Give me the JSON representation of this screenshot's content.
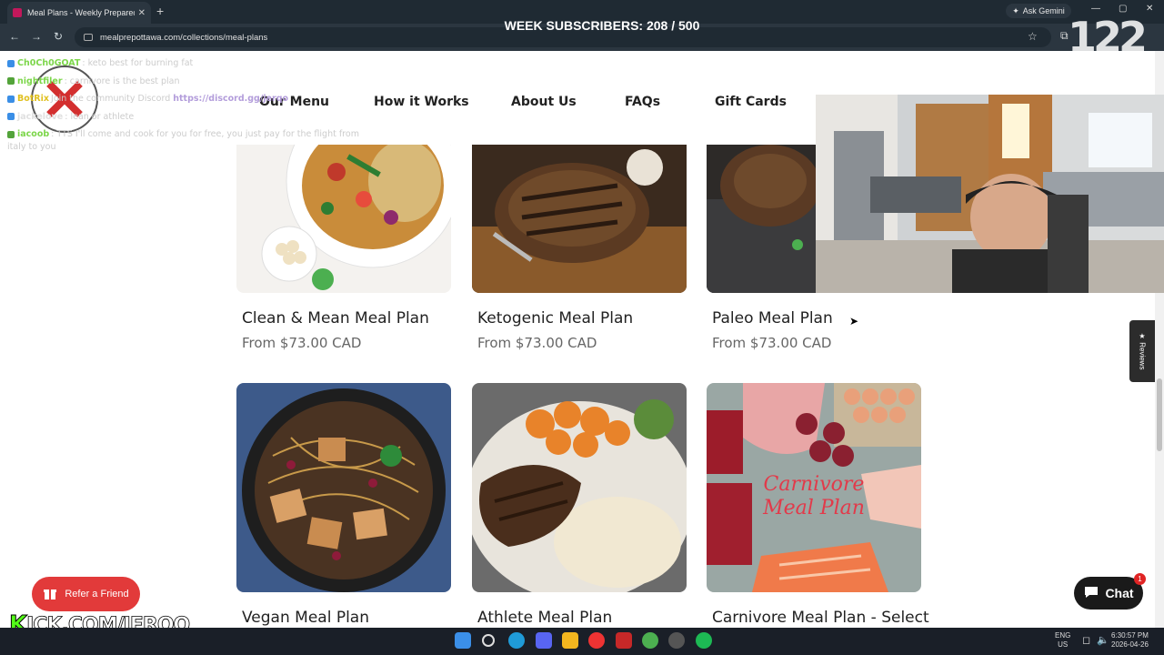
{
  "browser": {
    "tab_title": "Meal Plans - Weekly Prepared M",
    "url": "mealprepottawa.com/collections/meal-plans",
    "ask_label": "Ask Gemini"
  },
  "stream": {
    "subscribers": "WEEK SUBSCRIBERS: 208 / 500",
    "counter": "122",
    "kick_k": "K",
    "kick_rest": "ICK.COM/JERQO"
  },
  "chat": [
    {
      "user": "Ch0Ch0GOAT",
      "color": "#7cd64a",
      "msg": ": keto best for burning fat"
    },
    {
      "user": "nightfiler",
      "color": "#7cd64a",
      "msg": ": carnivore is the best plan"
    },
    {
      "user": "BotRix",
      "color": "#e0c020",
      "msg": "Join the community Discord ",
      "link": "https://discord.gg/jerqo"
    },
    {
      "user": "jackelove",
      "color": "#e0e0e0",
      "msg": ": lean or athlete"
    },
    {
      "user": "iacoob",
      "color": "#7cd64a",
      "msg": ": TTS I'll come and cook for you for free, you just pay for the flight from"
    },
    {
      "user": "",
      "color": "#ccc",
      "msg": "italy to you"
    }
  ],
  "nav": {
    "items": [
      "Our Menu",
      "How it Works",
      "About Us",
      "FAQs",
      "Gift Cards"
    ]
  },
  "products": [
    {
      "title": "Clean & Mean Meal Plan",
      "price": "From $73.00 CAD"
    },
    {
      "title": "Ketogenic Meal Plan",
      "price": "From $73.00 CAD"
    },
    {
      "title": "Paleo Meal Plan",
      "price": "From $73.00 CAD"
    },
    {
      "title": "Vegan Meal Plan",
      "price": ""
    },
    {
      "title": "Athlete Meal Plan",
      "price": ""
    },
    {
      "title": "Carnivore Meal Plan - Select",
      "price": ""
    }
  ],
  "carnivore_image_text": "Carnivore Meal Plan",
  "widgets": {
    "reviews": "★ Reviews",
    "chat": "Chat",
    "chat_badge": "1",
    "refer": "Refer a Friend"
  },
  "tray": {
    "lang1": "ENG",
    "lang2": "US",
    "time": "6:30:57 PM",
    "date": "2026-04-26"
  }
}
